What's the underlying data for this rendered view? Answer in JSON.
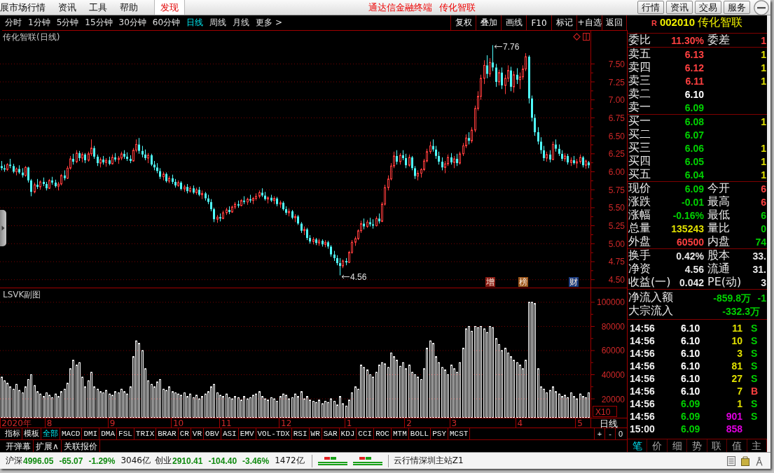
{
  "menu_bar": {
    "items": [
      "展市场行情",
      "资讯",
      "工具",
      "帮助"
    ],
    "discover": "发现",
    "titles": [
      "通达信金融终端",
      "传化智联"
    ],
    "buttons": [
      "行情",
      "资讯",
      "交易",
      "服务"
    ]
  },
  "period_tabs": [
    {
      "label": "分时",
      "selected": false
    },
    {
      "label": "1分钟",
      "selected": false
    },
    {
      "label": "5分钟",
      "selected": false
    },
    {
      "label": "15分钟",
      "selected": false
    },
    {
      "label": "30分钟",
      "selected": false
    },
    {
      "label": "60分钟",
      "selected": false
    },
    {
      "label": "日线",
      "selected": true
    },
    {
      "label": "周线",
      "selected": false
    },
    {
      "label": "月线",
      "selected": false
    },
    {
      "label": "更多 >",
      "selected": false
    }
  ],
  "tool_buttons": [
    "复权",
    "叠加",
    "画线",
    "F10",
    "标记",
    "+自选",
    "返回"
  ],
  "chart_area": {
    "chart_data": [
      {
        "type": "candlestick",
        "title": "传化智联(日线)",
        "tick_labels": "y",
        "grid": true,
        "ylim": [
          4.39,
          7.97
        ],
        "yticks": [
          {
            "value": 4.5,
            "label": "4.50"
          },
          {
            "value": 4.75,
            "label": "4.75"
          },
          {
            "value": 5,
            "label": "5.00"
          },
          {
            "value": 5.25,
            "label": "5.25"
          },
          {
            "value": 5.5,
            "label": "5.50"
          },
          {
            "value": 5.75,
            "label": "5.75"
          },
          {
            "value": 6,
            "label": "6.00"
          },
          {
            "value": 6.25,
            "label": "6.25"
          },
          {
            "value": 6.5,
            "label": "6.50"
          },
          {
            "value": 6.75,
            "label": "6.75"
          },
          {
            "value": 7,
            "label": "7.00"
          },
          {
            "value": 7.25,
            "label": "7.25"
          },
          {
            "value": 7.5,
            "label": "7.50"
          }
        ],
        "annotations": [
          "7.76",
          "4.56"
        ],
        "ohlc": [
          [
            6.08,
            6.15,
            6.02,
            6.05
          ],
          [
            6.05,
            6.1,
            6.0,
            6.03
          ],
          [
            6.03,
            6.12,
            6.01,
            6.1
          ],
          [
            6.1,
            6.18,
            6.05,
            6.08
          ],
          [
            6.08,
            6.11,
            5.98,
            6.0
          ],
          [
            6.0,
            6.06,
            5.95,
            6.04
          ],
          [
            6.04,
            6.09,
            5.97,
            5.99
          ],
          [
            5.99,
            6.05,
            5.92,
            5.95
          ],
          [
            5.95,
            6.08,
            5.93,
            6.06
          ],
          [
            6.06,
            6.07,
            5.85,
            5.88
          ],
          [
            5.88,
            5.9,
            5.66,
            5.72
          ],
          [
            5.72,
            5.85,
            5.7,
            5.82
          ],
          [
            5.82,
            5.9,
            5.76,
            5.79
          ],
          [
            5.79,
            5.88,
            5.75,
            5.86
          ],
          [
            5.86,
            5.92,
            5.8,
            5.83
          ],
          [
            5.83,
            5.86,
            5.74,
            5.77
          ],
          [
            5.77,
            5.9,
            5.76,
            5.88
          ],
          [
            5.88,
            5.93,
            5.82,
            5.85
          ],
          [
            5.85,
            5.89,
            5.78,
            5.8
          ],
          [
            5.8,
            5.86,
            5.74,
            5.83
          ],
          [
            5.83,
            5.97,
            5.81,
            5.95
          ],
          [
            5.95,
            6.02,
            5.88,
            5.91
          ],
          [
            5.91,
            6.08,
            5.9,
            6.05
          ],
          [
            6.05,
            6.22,
            6.03,
            6.18
          ],
          [
            6.18,
            6.25,
            6.1,
            6.14
          ],
          [
            6.14,
            6.3,
            6.12,
            6.26
          ],
          [
            6.26,
            6.29,
            6.15,
            6.19
          ],
          [
            6.19,
            6.27,
            6.13,
            6.24
          ],
          [
            6.24,
            6.26,
            6.12,
            6.16
          ],
          [
            6.16,
            6.28,
            6.14,
            6.25
          ],
          [
            6.25,
            6.45,
            6.22,
            6.33
          ],
          [
            6.33,
            6.36,
            6.18,
            6.21
          ],
          [
            6.21,
            6.24,
            6.08,
            6.12
          ],
          [
            6.12,
            6.2,
            6.06,
            6.17
          ],
          [
            6.17,
            6.22,
            6.1,
            6.13
          ],
          [
            6.13,
            6.19,
            6.07,
            6.16
          ],
          [
            6.16,
            6.21,
            6.09,
            6.11
          ],
          [
            6.11,
            6.24,
            6.1,
            6.2
          ],
          [
            6.2,
            6.26,
            6.14,
            6.17
          ],
          [
            6.17,
            6.22,
            6.11,
            6.19
          ],
          [
            6.19,
            6.28,
            6.16,
            6.25
          ],
          [
            6.25,
            6.3,
            6.18,
            6.21
          ],
          [
            6.21,
            6.27,
            6.15,
            6.18
          ],
          [
            6.18,
            6.23,
            6.12,
            6.15
          ],
          [
            6.15,
            6.33,
            6.14,
            6.3
          ],
          [
            6.3,
            6.45,
            6.27,
            6.38
          ],
          [
            6.38,
            6.47,
            6.25,
            6.29
          ],
          [
            6.29,
            6.36,
            6.2,
            6.24
          ],
          [
            6.24,
            6.31,
            6.16,
            6.19
          ],
          [
            6.19,
            6.26,
            6.12,
            6.23
          ],
          [
            6.23,
            6.25,
            6.08,
            6.1
          ],
          [
            6.1,
            6.15,
            6.02,
            6.06
          ],
          [
            6.06,
            6.12,
            5.98,
            6.01
          ],
          [
            6.01,
            6.05,
            5.9,
            5.93
          ],
          [
            5.93,
            6.0,
            5.88,
            5.97
          ],
          [
            5.97,
            5.99,
            5.85,
            5.87
          ],
          [
            5.87,
            5.94,
            5.84,
            5.91
          ],
          [
            5.91,
            5.96,
            5.83,
            5.86
          ],
          [
            5.86,
            5.9,
            5.78,
            5.81
          ],
          [
            5.81,
            5.88,
            5.79,
            5.85
          ],
          [
            5.85,
            5.87,
            5.74,
            5.76
          ],
          [
            5.76,
            5.82,
            5.72,
            5.79
          ],
          [
            5.79,
            5.83,
            5.7,
            5.73
          ],
          [
            5.73,
            5.8,
            5.71,
            5.77
          ],
          [
            5.77,
            5.81,
            5.69,
            5.71
          ],
          [
            5.71,
            5.78,
            5.68,
            5.75
          ],
          [
            5.75,
            5.79,
            5.66,
            5.68
          ],
          [
            5.68,
            5.74,
            5.62,
            5.7
          ],
          [
            5.7,
            5.72,
            5.6,
            5.63
          ],
          [
            5.63,
            5.68,
            5.55,
            5.58
          ],
          [
            5.58,
            5.62,
            5.45,
            5.48
          ],
          [
            5.48,
            5.5,
            5.3,
            5.34
          ],
          [
            5.34,
            5.4,
            5.29,
            5.37
          ],
          [
            5.37,
            5.42,
            5.31,
            5.35
          ],
          [
            5.35,
            5.46,
            5.34,
            5.43
          ],
          [
            5.43,
            5.5,
            5.4,
            5.47
          ],
          [
            5.47,
            5.52,
            5.41,
            5.44
          ],
          [
            5.44,
            5.53,
            5.43,
            5.51
          ],
          [
            5.51,
            5.58,
            5.48,
            5.55
          ],
          [
            5.55,
            5.6,
            5.5,
            5.53
          ],
          [
            5.53,
            5.62,
            5.52,
            5.6
          ],
          [
            5.6,
            5.66,
            5.55,
            5.58
          ],
          [
            5.58,
            5.64,
            5.54,
            5.62
          ],
          [
            5.62,
            5.68,
            5.57,
            5.6
          ],
          [
            5.6,
            5.65,
            5.55,
            5.63
          ],
          [
            5.63,
            5.7,
            5.6,
            5.66
          ],
          [
            5.66,
            5.74,
            5.63,
            5.71
          ],
          [
            5.71,
            5.77,
            5.65,
            5.67
          ],
          [
            5.67,
            5.72,
            5.6,
            5.62
          ],
          [
            5.62,
            5.66,
            5.56,
            5.64
          ],
          [
            5.64,
            5.68,
            5.58,
            5.6
          ],
          [
            5.6,
            5.66,
            5.55,
            5.63
          ],
          [
            5.63,
            5.65,
            5.52,
            5.55
          ],
          [
            5.55,
            5.6,
            5.5,
            5.57
          ],
          [
            5.57,
            5.59,
            5.46,
            5.48
          ],
          [
            5.48,
            5.52,
            5.4,
            5.43
          ],
          [
            5.43,
            5.49,
            5.38,
            5.45
          ],
          [
            5.45,
            5.47,
            5.34,
            5.36
          ],
          [
            5.36,
            5.41,
            5.3,
            5.38
          ],
          [
            5.38,
            5.4,
            5.26,
            5.28
          ],
          [
            5.28,
            5.3,
            5.15,
            5.18
          ],
          [
            5.18,
            5.24,
            5.12,
            5.2
          ],
          [
            5.2,
            5.22,
            5.05,
            5.08
          ],
          [
            5.08,
            5.12,
            5.0,
            5.03
          ],
          [
            5.03,
            5.09,
            4.99,
            5.06
          ],
          [
            5.06,
            5.08,
            4.98,
            5.01
          ],
          [
            5.01,
            5.07,
            4.97,
            5.04
          ],
          [
            5.04,
            5.06,
            4.96,
            4.99
          ],
          [
            4.99,
            5.05,
            4.95,
            5.02
          ],
          [
            5.02,
            5.04,
            4.93,
            4.96
          ],
          [
            4.96,
            4.98,
            4.82,
            4.85
          ],
          [
            4.85,
            4.9,
            4.76,
            4.8
          ],
          [
            4.8,
            4.84,
            4.7,
            4.73
          ],
          [
            4.73,
            4.8,
            4.56,
            4.69
          ],
          [
            4.69,
            4.78,
            4.66,
            4.76
          ],
          [
            4.76,
            4.8,
            4.7,
            4.74
          ],
          [
            4.74,
            4.9,
            4.73,
            4.88
          ],
          [
            4.88,
            5.05,
            4.86,
            5.02
          ],
          [
            5.02,
            5.1,
            4.97,
            5.07
          ],
          [
            5.07,
            5.2,
            5.05,
            5.18
          ],
          [
            5.18,
            5.32,
            5.15,
            5.28
          ],
          [
            5.28,
            5.35,
            5.2,
            5.24
          ],
          [
            5.24,
            5.33,
            5.22,
            5.3
          ],
          [
            5.3,
            5.36,
            5.24,
            5.27
          ],
          [
            5.27,
            5.34,
            5.21,
            5.25
          ],
          [
            5.25,
            5.38,
            5.24,
            5.35
          ],
          [
            5.35,
            5.42,
            5.28,
            5.31
          ],
          [
            5.31,
            5.58,
            5.3,
            5.55
          ],
          [
            5.55,
            5.82,
            5.53,
            5.78
          ],
          [
            5.78,
            5.95,
            5.74,
            5.9
          ],
          [
            5.9,
            6.12,
            5.88,
            6.08
          ],
          [
            6.08,
            6.28,
            6.05,
            6.22
          ],
          [
            6.22,
            6.3,
            6.1,
            6.14
          ],
          [
            6.14,
            6.26,
            6.1,
            6.23
          ],
          [
            6.23,
            6.3,
            6.16,
            6.19
          ],
          [
            6.19,
            6.25,
            6.05,
            6.09
          ],
          [
            6.09,
            6.24,
            6.07,
            6.2
          ],
          [
            6.2,
            6.22,
            6.02,
            6.05
          ],
          [
            6.05,
            6.08,
            5.9,
            5.94
          ],
          [
            5.94,
            6.02,
            5.88,
            5.98
          ],
          [
            5.98,
            6.05,
            5.92,
            6.03
          ],
          [
            6.03,
            6.18,
            6.01,
            6.15
          ],
          [
            6.15,
            6.32,
            6.13,
            6.28
          ],
          [
            6.28,
            6.42,
            6.25,
            6.36
          ],
          [
            6.36,
            6.45,
            6.28,
            6.31
          ],
          [
            6.31,
            6.36,
            6.18,
            6.22
          ],
          [
            6.22,
            6.28,
            6.1,
            6.14
          ],
          [
            6.14,
            6.2,
            6.02,
            6.06
          ],
          [
            6.06,
            6.15,
            5.98,
            6.11
          ],
          [
            6.11,
            6.24,
            6.08,
            6.2
          ],
          [
            6.2,
            6.26,
            6.1,
            6.13
          ],
          [
            6.13,
            6.22,
            6.05,
            6.18
          ],
          [
            6.18,
            6.25,
            6.08,
            6.12
          ],
          [
            6.12,
            6.28,
            6.1,
            6.25
          ],
          [
            6.25,
            6.4,
            6.22,
            6.36
          ],
          [
            6.36,
            6.52,
            6.33,
            6.47
          ],
          [
            6.47,
            6.55,
            6.38,
            6.43
          ],
          [
            6.43,
            6.62,
            6.4,
            6.58
          ],
          [
            6.58,
            6.92,
            6.55,
            6.88
          ],
          [
            6.88,
            7.12,
            6.85,
            7.05
          ],
          [
            7.05,
            7.35,
            7.0,
            7.3
          ],
          [
            7.3,
            7.55,
            7.22,
            7.48
          ],
          [
            7.48,
            7.62,
            7.3,
            7.36
          ],
          [
            7.36,
            7.58,
            7.32,
            7.52
          ],
          [
            7.52,
            7.76,
            7.4,
            7.45
          ],
          [
            7.45,
            7.5,
            7.18,
            7.25
          ],
          [
            7.25,
            7.42,
            7.2,
            7.38
          ],
          [
            7.38,
            7.45,
            7.15,
            7.2
          ],
          [
            7.2,
            7.35,
            7.08,
            7.3
          ],
          [
            7.3,
            7.48,
            7.25,
            7.41
          ],
          [
            7.41,
            7.46,
            7.12,
            7.18
          ],
          [
            7.18,
            7.4,
            7.1,
            7.35
          ],
          [
            7.35,
            7.44,
            7.22,
            7.28
          ],
          [
            7.28,
            7.38,
            7.15,
            7.32
          ],
          [
            7.32,
            7.48,
            7.28,
            7.43
          ],
          [
            7.43,
            7.65,
            7.4,
            7.6
          ],
          [
            7.6,
            7.62,
            6.95,
            7.02
          ],
          [
            7.02,
            7.06,
            6.7,
            6.75
          ],
          [
            6.75,
            6.8,
            6.5,
            6.55
          ],
          [
            6.55,
            6.62,
            6.38,
            6.42
          ],
          [
            6.42,
            6.48,
            6.25,
            6.3
          ],
          [
            6.3,
            6.36,
            6.15,
            6.19
          ],
          [
            6.19,
            6.28,
            6.14,
            6.24
          ],
          [
            6.24,
            6.3,
            6.13,
            6.17
          ],
          [
            6.17,
            6.42,
            6.16,
            6.38
          ],
          [
            6.38,
            6.45,
            6.28,
            6.32
          ],
          [
            6.32,
            6.38,
            6.22,
            6.25
          ],
          [
            6.25,
            6.3,
            6.15,
            6.18
          ],
          [
            6.18,
            6.26,
            6.14,
            6.22
          ],
          [
            6.22,
            6.25,
            6.1,
            6.13
          ],
          [
            6.13,
            6.2,
            6.08,
            6.16
          ],
          [
            6.16,
            6.22,
            6.1,
            6.12
          ],
          [
            6.12,
            6.18,
            6.05,
            6.14
          ],
          [
            6.14,
            6.24,
            6.11,
            6.2
          ],
          [
            6.2,
            6.22,
            6.06,
            6.09
          ],
          [
            6.09,
            6.17,
            6.04,
            6.15
          ],
          [
            6.13,
            6.15,
            6.05,
            6.09
          ]
        ]
      },
      {
        "type": "bar",
        "title": "LSVK副图",
        "ylabel": "X10",
        "color": "#ffffff",
        "grid": true,
        "ylim": [
          4350,
          112170
        ],
        "yticks": [
          20000,
          40000,
          60000,
          80000,
          100000
        ],
        "categories": [
          null,
          null,
          null,
          null,
          null,
          "2020年",
          null,
          null,
          null,
          null,
          null,
          null,
          null,
          null,
          null,
          null,
          "8",
          null,
          null,
          null,
          null,
          null,
          null,
          null,
          null,
          null,
          null,
          null,
          null,
          null,
          null,
          null,
          null,
          null,
          null,
          null,
          null,
          "9",
          null,
          null,
          null,
          null,
          null,
          null,
          null,
          null,
          null,
          null,
          null,
          null,
          null,
          null,
          null,
          null,
          null,
          null,
          null,
          null,
          null,
          "10",
          null,
          null,
          null,
          null,
          null,
          null,
          null,
          null,
          null,
          null,
          null,
          null,
          null,
          null,
          null,
          "11",
          null,
          null,
          null,
          null,
          null,
          null,
          null,
          null,
          null,
          null,
          null,
          null,
          null,
          null,
          null,
          null,
          null,
          null,
          null,
          "12",
          null,
          null,
          null,
          null,
          null,
          null,
          null,
          null,
          null,
          null,
          null,
          null,
          null,
          null,
          null,
          null,
          null,
          null,
          null,
          null,
          "1",
          null,
          null,
          null,
          null,
          null,
          null,
          null,
          null,
          null,
          null,
          null,
          null,
          null,
          null,
          null,
          null,
          null,
          null,
          null,
          "2",
          null,
          null,
          null,
          null,
          null,
          null,
          null,
          null,
          null,
          null,
          null,
          null,
          null,
          null,
          "3",
          null,
          null,
          null,
          null,
          null,
          null,
          null,
          null,
          null,
          null,
          null,
          null,
          null,
          null,
          null,
          null,
          null,
          null,
          null,
          null,
          null,
          "4",
          null,
          null,
          null,
          null,
          null,
          null,
          null,
          null,
          null,
          null,
          null,
          null,
          null,
          null,
          null,
          null,
          null,
          null,
          null,
          "5",
          null,
          null,
          null
        ],
        "values": [
          38000,
          35000,
          33000,
          30000,
          28000,
          32000,
          27000,
          25000,
          30000,
          36000,
          40000,
          31000,
          26000,
          24000,
          22000,
          25000,
          23000,
          21000,
          24000,
          22000,
          26000,
          28000,
          33000,
          45000,
          52000,
          48000,
          50000,
          38000,
          30000,
          35000,
          42000,
          30000,
          28000,
          26000,
          25000,
          27000,
          24000,
          23000,
          26000,
          25000,
          28000,
          26000,
          24000,
          30000,
          55000,
          68000,
          66000,
          60000,
          45000,
          35000,
          32000,
          30000,
          34000,
          36000,
          28000,
          27000,
          30000,
          26000,
          25000,
          24000,
          23000,
          25000,
          22000,
          24000,
          21000,
          23000,
          20000,
          22000,
          24000,
          26000,
          30000,
          32000,
          25000,
          23000,
          22000,
          24000,
          21000,
          20000,
          22000,
          21000,
          19000,
          22000,
          20000,
          21000,
          23000,
          24000,
          26000,
          22000,
          20000,
          19000,
          21000,
          20000,
          18000,
          22000,
          24000,
          23000,
          20000,
          21000,
          24000,
          22000,
          26000,
          20000,
          22000,
          19000,
          18000,
          17000,
          19000,
          16000,
          18000,
          17000,
          20000,
          18000,
          15000,
          22000,
          16000,
          14000,
          19000,
          25000,
          30000,
          28000,
          48000,
          46000,
          44000,
          40000,
          38000,
          42000,
          48000,
          50000,
          49000,
          46000,
          58000,
          55000,
          52000,
          47000,
          50000,
          45000,
          48000,
          42000,
          40000,
          38000,
          36000,
          45000,
          62000,
          68000,
          66000,
          55000,
          50000,
          46000,
          44000,
          40000,
          48000,
          45000,
          42000,
          50000,
          62000,
          78000,
          80000,
          76000,
          80000,
          79000,
          80000,
          78000,
          75000,
          80000,
          79000,
          70000,
          65000,
          60000,
          62000,
          58000,
          55000,
          52000,
          50000,
          48000,
          45000,
          52000,
          100000,
          100000,
          99000,
          45000,
          30000,
          28000,
          25000,
          27000,
          30000,
          26000,
          24000,
          22000,
          23000,
          21000,
          25000,
          22000,
          20000,
          24000,
          22000,
          21000,
          25000
        ]
      }
    ],
    "event_tags": [
      {
        "label": "增",
        "color": "#8c1c14"
      },
      {
        "label": "榜",
        "color": "#a0581c"
      },
      {
        "label": "财",
        "color": "#1c3c80"
      }
    ],
    "period_label": "日线"
  },
  "indicator_tabs": [
    {
      "label": "指标",
      "selected": false
    },
    {
      "label": "模板",
      "selected": false
    },
    {
      "label": "全部",
      "selected": true
    },
    {
      "label": "MACD",
      "selected": false
    },
    {
      "label": "DMI",
      "selected": false
    },
    {
      "label": "DMA",
      "selected": false
    },
    {
      "label": "FSL",
      "selected": false
    },
    {
      "label": "TRIX",
      "selected": false
    },
    {
      "label": "BRAR",
      "selected": false
    },
    {
      "label": "CR",
      "selected": false
    },
    {
      "label": "VR",
      "selected": false
    },
    {
      "label": "OBV",
      "selected": false
    },
    {
      "label": "ASI",
      "selected": false
    },
    {
      "label": "EMV",
      "selected": false
    },
    {
      "label": "VOL-TDX",
      "selected": false
    },
    {
      "label": "RSI",
      "selected": false
    },
    {
      "label": "WR",
      "selected": false
    },
    {
      "label": "SAR",
      "selected": false
    },
    {
      "label": "KDJ",
      "selected": false
    },
    {
      "label": "CCI",
      "selected": false
    },
    {
      "label": "ROC",
      "selected": false
    },
    {
      "label": "MTM",
      "selected": false
    },
    {
      "label": "BOLL",
      "selected": false
    },
    {
      "label": "PSY",
      "selected": false
    },
    {
      "label": "MCST",
      "selected": false
    }
  ],
  "zoom_buttons": [
    "+",
    "-",
    "0"
  ],
  "extra_tabs": [
    "开弹幕",
    "扩展∧",
    "关联报价"
  ],
  "quote_panel": {
    "header": {
      "flag": "R",
      "code": "002010",
      "name": "传化智联"
    },
    "sections": [
      {
        "kind": "pair",
        "rows": [
          {
            "items": [
              {
                "label": "委比",
                "value": "11.30%",
                "color": "#ff4040"
              },
              {
                "label": "委差",
                "value": "1",
                "color": "#ff4040"
              }
            ]
          }
        ]
      },
      {
        "kind": "book",
        "rows": [
          {
            "items": [
              {
                "label": "卖五",
                "value": "6.13",
                "color": "#ff4040"
              },
              {
                "value": "1",
                "color": "#e0e000"
              }
            ]
          },
          {
            "items": [
              {
                "label": "卖四",
                "value": "6.12",
                "color": "#ff4040"
              },
              {
                "value": "1",
                "color": "#e0e000"
              }
            ]
          },
          {
            "items": [
              {
                "label": "卖三",
                "value": "6.11",
                "color": "#ff4040"
              },
              {
                "value": "1",
                "color": "#e0e000"
              }
            ]
          },
          {
            "items": [
              {
                "label": "卖二",
                "value": "6.10",
                "color": "#ffffff"
              }
            ]
          },
          {
            "items": [
              {
                "label": "卖一",
                "value": "6.09",
                "color": "#00d000"
              }
            ]
          }
        ]
      },
      {
        "kind": "book",
        "rows": [
          {
            "items": [
              {
                "label": "买一",
                "value": "6.08",
                "color": "#00d000"
              },
              {
                "value": "1",
                "color": "#e0e000"
              }
            ]
          },
          {
            "items": [
              {
                "label": "买二",
                "value": "6.07",
                "color": "#00d000"
              }
            ]
          },
          {
            "items": [
              {
                "label": "买三",
                "value": "6.06",
                "color": "#00d000"
              },
              {
                "value": "1",
                "color": "#e0e000"
              }
            ]
          },
          {
            "items": [
              {
                "label": "买四",
                "value": "6.05",
                "color": "#00d000"
              },
              {
                "value": "1",
                "color": "#e0e000"
              }
            ]
          },
          {
            "items": [
              {
                "label": "买五",
                "value": "6.04",
                "color": "#00d000"
              },
              {
                "value": "1",
                "color": "#e0e000"
              }
            ]
          }
        ]
      },
      {
        "kind": "pair",
        "rows": [
          {
            "items": [
              {
                "label": "现价",
                "value": "6.09",
                "color": "#00d000"
              },
              {
                "label": "今开",
                "value": "6",
                "color": "#ff4040"
              }
            ]
          },
          {
            "items": [
              {
                "label": "涨跌",
                "value": "-0.01",
                "color": "#00d000"
              },
              {
                "label": "最高",
                "value": "6",
                "color": "#ff4040"
              }
            ]
          },
          {
            "items": [
              {
                "label": "涨幅",
                "value": "-0.16%",
                "color": "#00d000"
              },
              {
                "label": "最低",
                "value": "6",
                "color": "#00d000"
              }
            ]
          },
          {
            "items": [
              {
                "label": "总量",
                "value": "135243",
                "color": "#e0e000"
              },
              {
                "label": "量比",
                "value": "0",
                "color": "#00d000"
              }
            ]
          },
          {
            "items": [
              {
                "label": "外盘",
                "value": "60500",
                "color": "#ff4040"
              },
              {
                "label": "内盘",
                "value": "74",
                "color": "#00d000"
              }
            ]
          }
        ]
      },
      {
        "kind": "pair",
        "rows": [
          {
            "items": [
              {
                "label": "换手",
                "value": "0.42%",
                "color": "#e8e8e8"
              },
              {
                "label": "股本",
                "value": "33.",
                "color": "#e8e8e8"
              }
            ]
          },
          {
            "items": [
              {
                "label": "净资",
                "value": "4.56",
                "color": "#e8e8e8"
              },
              {
                "label": "流通",
                "value": "31.",
                "color": "#e8e8e8"
              }
            ]
          },
          {
            "items": [
              {
                "label": "收益(一)",
                "value": "0.042",
                "color": "#e8e8e8"
              },
              {
                "label": "PE(动)",
                "value": "3",
                "color": "#e8e8e8"
              }
            ]
          }
        ]
      },
      {
        "kind": "flow",
        "rows": [
          {
            "items": [
              {
                "label": "净流入额",
                "value": "-859.8万",
                "color": "#00d000"
              },
              {
                "value": "-1",
                "color": "#00d000"
              }
            ]
          },
          {
            "items": [
              {
                "label": "大宗流入",
                "value": "-332.3万",
                "color": "#00d000"
              }
            ]
          }
        ]
      }
    ],
    "trades": [
      {
        "time": "14:56",
        "price": "6.10",
        "color": "#ffffff",
        "volume": "11",
        "large": false,
        "side": "S",
        "kind": "sell"
      },
      {
        "time": "14:56",
        "price": "6.10",
        "color": "#ffffff",
        "volume": "10",
        "large": false,
        "side": "S",
        "kind": "sell"
      },
      {
        "time": "14:56",
        "price": "6.10",
        "color": "#ffffff",
        "volume": "3",
        "large": false,
        "side": "S",
        "kind": "sell"
      },
      {
        "time": "14:56",
        "price": "6.10",
        "color": "#ffffff",
        "volume": "81",
        "large": false,
        "side": "S",
        "kind": "sell"
      },
      {
        "time": "14:56",
        "price": "6.10",
        "color": "#ffffff",
        "volume": "27",
        "large": false,
        "side": "S",
        "kind": "sell"
      },
      {
        "time": "14:56",
        "price": "6.10",
        "color": "#ffffff",
        "volume": "7",
        "large": false,
        "side": "B",
        "kind": "buy"
      },
      {
        "time": "14:56",
        "price": "6.09",
        "color": "#00d000",
        "volume": "1",
        "large": false,
        "side": "S",
        "kind": "sell"
      },
      {
        "time": "14:56",
        "price": "6.09",
        "color": "#00d000",
        "volume": "901",
        "large": true,
        "side": "S",
        "kind": "sell"
      },
      {
        "time": "15:00",
        "price": "6.09",
        "color": "#00d000",
        "volume": "858",
        "large": true
      }
    ],
    "tabs": [
      {
        "label": "笔",
        "selected": true
      },
      {
        "label": "价",
        "selected": false
      },
      {
        "label": "细",
        "selected": false
      },
      {
        "label": "势",
        "selected": false
      },
      {
        "label": "联",
        "selected": false
      },
      {
        "label": "值",
        "selected": false
      },
      {
        "label": "主",
        "selected": false
      }
    ]
  },
  "status_bar": {
    "indices": [
      {
        "name": "沪深",
        "value": "4996.05",
        "change": "-65.07",
        "percent": "-1.29%",
        "amount": "3046亿",
        "color": "#108a10"
      },
      {
        "name": "创业",
        "value": "2910.41",
        "change": "-104.40",
        "percent": "-3.46%",
        "amount": "1472亿",
        "color": "#108a10"
      }
    ],
    "server": "云行情深圳主站Z1"
  }
}
